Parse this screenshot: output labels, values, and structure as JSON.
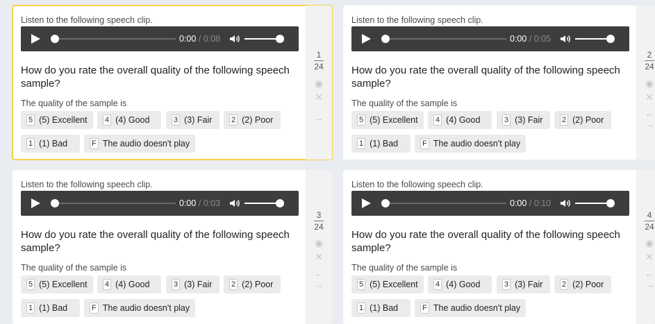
{
  "prompt": "Listen to the following speech clip.",
  "question": "How do you rate the overall quality of the following speech sample?",
  "quality_label": "The quality of the sample is",
  "options": [
    {
      "key": "5",
      "label": "(5) Excellent"
    },
    {
      "key": "4",
      "label": "(4) Good"
    },
    {
      "key": "3",
      "label": "(3) Fair"
    },
    {
      "key": "2",
      "label": "(2) Poor"
    },
    {
      "key": "1",
      "label": "(1) Bad"
    },
    {
      "key": "F",
      "label": "The audio doesn't play"
    }
  ],
  "time_separator": "/",
  "icons": {
    "play": "play-icon",
    "volume": "volume-icon",
    "view": "eye-icon",
    "close": "close-icon",
    "back": "arrow-left-icon",
    "forward": "arrow-right-icon"
  },
  "colors": {
    "active_border": "#f7d24a",
    "player_bg": "#3d3d3d",
    "option_bg": "#ebebeb",
    "sidebar_bg": "#f2f2f2"
  },
  "tasks": [
    {
      "number": "1",
      "total": "24",
      "current_time": "0:00",
      "duration": "0:08",
      "active": true,
      "has_back": false
    },
    {
      "number": "2",
      "total": "24",
      "current_time": "0:00",
      "duration": "0:05",
      "active": false,
      "has_back": true
    },
    {
      "number": "3",
      "total": "24",
      "current_time": "0:00",
      "duration": "0:03",
      "active": false,
      "has_back": true
    },
    {
      "number": "4",
      "total": "24",
      "current_time": "0:00",
      "duration": "0:10",
      "active": false,
      "has_back": true
    }
  ]
}
